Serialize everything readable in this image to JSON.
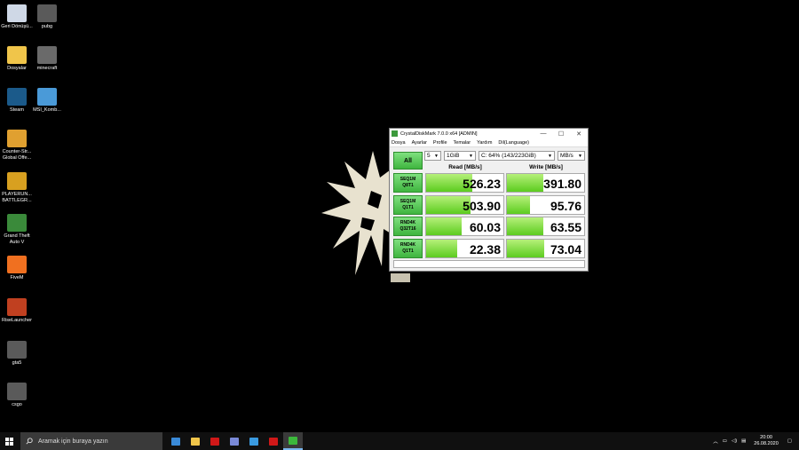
{
  "desktop": {
    "icons": [
      {
        "label": "Geri Dönüşü...",
        "color": "#cfd8e6"
      },
      {
        "label": "pubg",
        "color": "#5a5a5a"
      },
      {
        "label": "Dosyalar",
        "color": "#f0c54a"
      },
      {
        "label": "minecraft",
        "color": "#6a6a6a"
      },
      {
        "label": "Steam",
        "color": "#1b5a8a"
      },
      {
        "label": "MSI_Komb...",
        "color": "#4a9ad8"
      },
      {
        "label": "Counter-Str... Global Offe...",
        "color": "#e0a030"
      },
      {
        "label": "PLAYERUN... BATTLEGR...",
        "color": "#d8a020"
      },
      {
        "label": "Grand Theft Auto V",
        "color": "#3a8a3a"
      },
      {
        "label": "FiveM",
        "color": "#f07020"
      },
      {
        "label": "RiseLauncher",
        "color": "#c04020"
      },
      {
        "label": "gta5",
        "color": "#5a5a5a"
      },
      {
        "label": "csgo",
        "color": "#5a5a5a"
      }
    ]
  },
  "window": {
    "title": "CrystalDiskMark 7.0.0 x64 [ADMIN]",
    "minimize": "—",
    "maximize": "☐",
    "close": "✕",
    "menu": [
      "Dosya",
      "Ayarlar",
      "Profile",
      "Temalar",
      "Yardım",
      "Dil(Language)"
    ],
    "all_button": "All",
    "count_select": "5",
    "size_select": "1GiB",
    "drive_select": "C: 64% (143/223GiB)",
    "unit_select": "MB/s",
    "read_header": "Read [MB/s]",
    "write_header": "Write [MB/s]",
    "rows": [
      {
        "l1": "SEQ1M",
        "l2": "Q8T1",
        "read": "526.23",
        "write": "391.80",
        "read_fill": 0.6,
        "write_fill": 0.47
      },
      {
        "l1": "SEQ1M",
        "l2": "Q1T1",
        "read": "503.90",
        "write": "95.76",
        "read_fill": 0.58,
        "write_fill": 0.3
      },
      {
        "l1": "RND4K",
        "l2": "Q32T16",
        "read": "60.03",
        "write": "63.55",
        "read_fill": 0.46,
        "write_fill": 0.47
      },
      {
        "l1": "RND4K",
        "l2": "Q1T1",
        "read": "22.38",
        "write": "73.04",
        "read_fill": 0.4,
        "write_fill": 0.48
      }
    ]
  },
  "taskbar": {
    "search_placeholder": "Aramak için buraya yazın",
    "time": "20:00",
    "date": "26.08.2020",
    "apps": [
      {
        "name": "edge",
        "color": "#3a8ad8"
      },
      {
        "name": "explorer",
        "color": "#f0c54a"
      },
      {
        "name": "netflix",
        "color": "#d01818"
      },
      {
        "name": "discord",
        "color": "#7a8ad8"
      },
      {
        "name": "mail",
        "color": "#3a9ae0"
      },
      {
        "name": "opera",
        "color": "#d01818"
      },
      {
        "name": "crystaldiskmark",
        "color": "#3cb83c"
      }
    ]
  }
}
